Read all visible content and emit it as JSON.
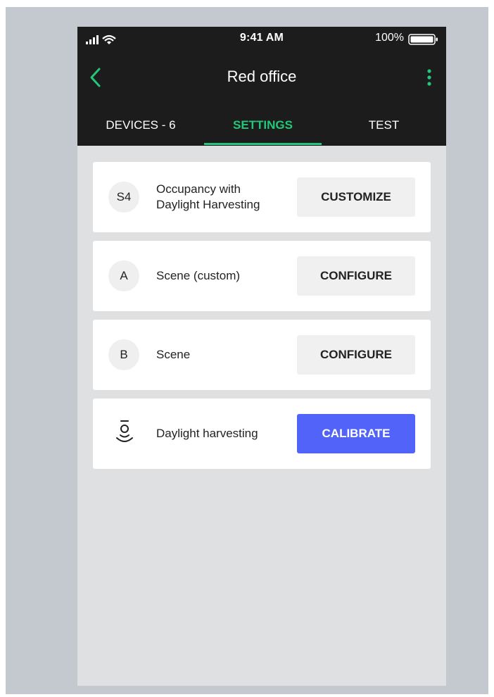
{
  "status_bar": {
    "time": "9:41 AM",
    "battery": "100%"
  },
  "header": {
    "title": "Red office"
  },
  "tabs": [
    {
      "label": "DEVICES - 6",
      "active": false
    },
    {
      "label": "SETTINGS",
      "active": true
    },
    {
      "label": "TEST",
      "active": false
    }
  ],
  "settings": [
    {
      "badge": "S4",
      "label_line1": "Occupancy with",
      "label_line2": "Daylight Harvesting",
      "button": "CUSTOMIZE"
    },
    {
      "badge": "A",
      "label": "Scene (custom)",
      "button": "CONFIGURE"
    },
    {
      "badge": "B",
      "label": "Scene",
      "button": "CONFIGURE"
    },
    {
      "icon": "daylight-sensor-icon",
      "label": "Daylight harvesting",
      "button": "CALIBRATE"
    }
  ],
  "colors": {
    "accent": "#24c77a",
    "primary_button": "#5263f9",
    "header_bg": "#1c1c1c",
    "content_bg": "#dfe0e2"
  }
}
